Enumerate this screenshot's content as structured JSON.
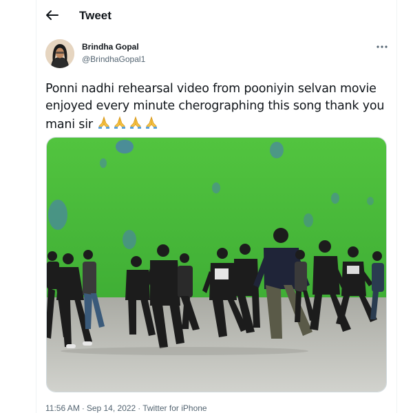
{
  "header": {
    "title": "Tweet",
    "back_icon": "arrow-left-icon"
  },
  "author": {
    "name": "Brindha Gopal",
    "handle": "@BrindhaGopal1"
  },
  "more_icon": "more-horizontal-icon",
  "tweet": {
    "text": "Ponni nadhi rehearsal video from pooniyin selvan movie enjoyed every minute cherographing this song thank you mani sir",
    "emoji": "🙏🙏🙏🙏"
  },
  "media": {
    "type": "video-still",
    "scene": "dance rehearsal in front of green screen"
  },
  "meta": {
    "time": "11:56 AM",
    "date": "Sep 14, 2022",
    "source": "Twitter for iPhone",
    "separator": "·"
  },
  "colors": {
    "text": "#0f1419",
    "secondary": "#536471",
    "border": "#cfd9de",
    "screen_green": "#4cbf3a"
  }
}
